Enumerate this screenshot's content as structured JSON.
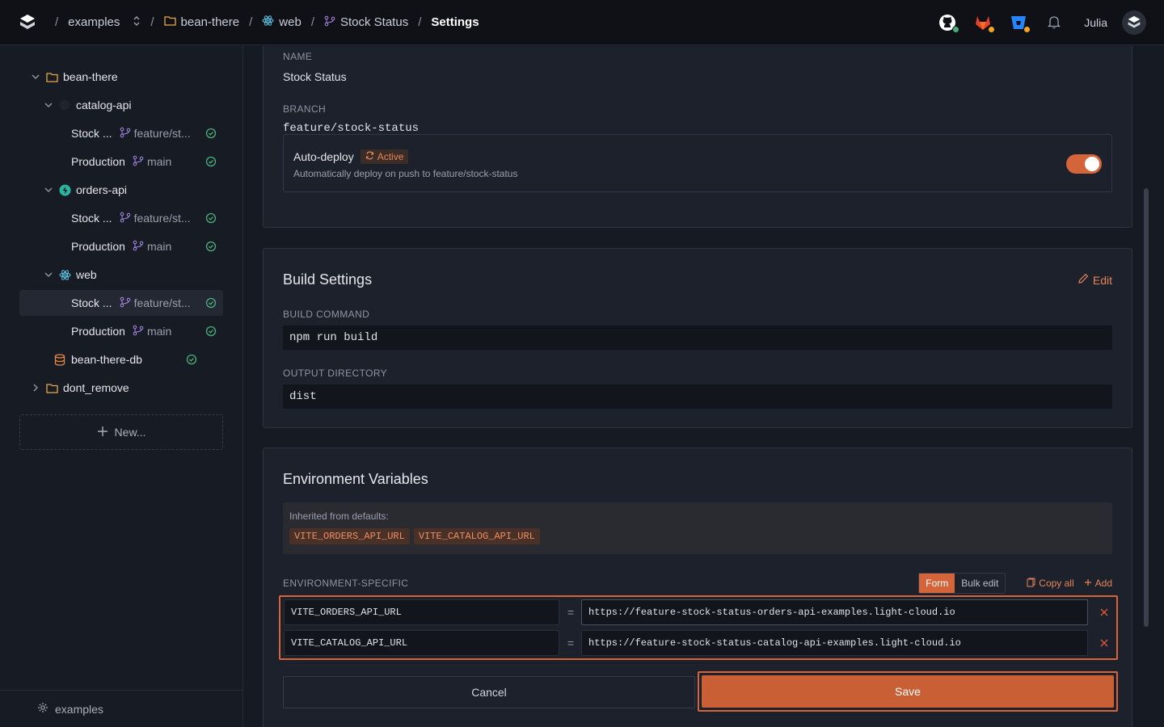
{
  "breadcrumb": {
    "workspace": "examples",
    "project": "bean-there",
    "app": "web",
    "environment": "Stock Status",
    "page": "Settings",
    "separator": "/"
  },
  "topbar": {
    "user_name": "Julia",
    "icons": [
      "github-icon",
      "gitlab-icon",
      "bitbucket-icon",
      "bell-icon"
    ]
  },
  "sidebar": {
    "tree": [
      {
        "label": "bean-there",
        "kind": "folder"
      },
      {
        "label": "catalog-api",
        "kind": "service"
      },
      {
        "label": "Stock ...",
        "branch": "feature/st...",
        "kind": "env"
      },
      {
        "label": "Production",
        "branch": "main",
        "kind": "env"
      },
      {
        "label": "orders-api",
        "kind": "service"
      },
      {
        "label": "Stock ...",
        "branch": "feature/st...",
        "kind": "env"
      },
      {
        "label": "Production",
        "branch": "main",
        "kind": "env"
      },
      {
        "label": "web",
        "kind": "service"
      },
      {
        "label": "Stock ...",
        "branch": "feature/st...",
        "kind": "env",
        "selected": true
      },
      {
        "label": "Production",
        "branch": "main",
        "kind": "env"
      },
      {
        "label": "bean-there-db",
        "kind": "database"
      },
      {
        "label": "dont_remove",
        "kind": "folder"
      }
    ],
    "new_label": "New...",
    "footer_label": "examples"
  },
  "general": {
    "name_label": "NAME",
    "name_value": "Stock Status",
    "branch_label": "BRANCH",
    "branch_value": "feature/stock-status",
    "autodeploy": {
      "title": "Auto-deploy",
      "badge": "Active",
      "description": "Automatically deploy on push to feature/stock-status",
      "enabled": true
    }
  },
  "build": {
    "title": "Build Settings",
    "edit_label": "Edit",
    "build_command_label": "BUILD COMMAND",
    "build_command": "npm run build",
    "output_dir_label": "OUTPUT DIRECTORY",
    "output_dir": "dist"
  },
  "env": {
    "title": "Environment Variables",
    "inherited_label": "Inherited from defaults:",
    "inherited": [
      "VITE_ORDERS_API_URL",
      "VITE_CATALOG_API_URL"
    ],
    "specific_label": "ENVIRONMENT-SPECIFIC",
    "mode_form": "Form",
    "mode_bulk": "Bulk edit",
    "copy_all": "Copy all",
    "add": "Add",
    "equals": "=",
    "vars": [
      {
        "key": "VITE_ORDERS_API_URL",
        "value": "https://feature-stock-status-orders-api-examples.light-cloud.io"
      },
      {
        "key": "VITE_CATALOG_API_URL",
        "value": "https://feature-stock-status-catalog-api-examples.light-cloud.io"
      }
    ]
  },
  "actions": {
    "cancel": "Cancel",
    "save": "Save"
  },
  "colors": {
    "accent": "#d4653a",
    "success": "#4caf7a"
  }
}
